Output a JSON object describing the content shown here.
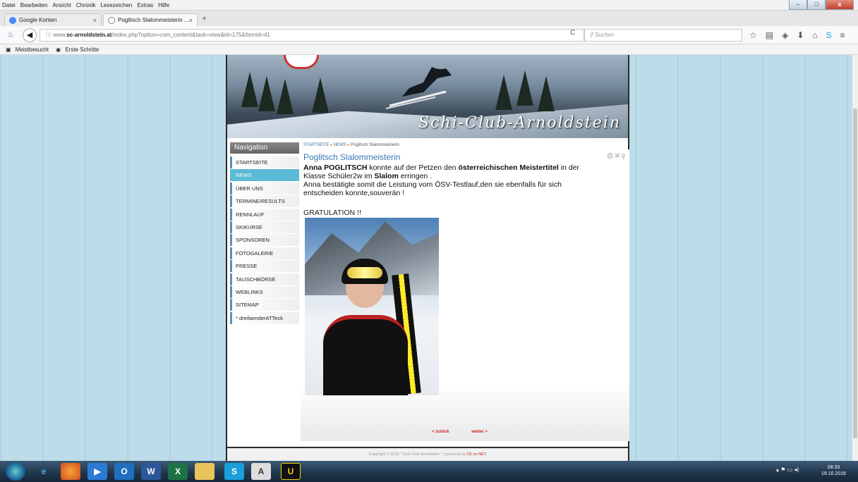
{
  "menubar": {
    "items": [
      "Datei",
      "Bearbeiten",
      "Ansicht",
      "Chronik",
      "Lesezeichen",
      "Extras",
      "Hilfe"
    ]
  },
  "window_controls": {
    "minimize": "–",
    "maximize": "□",
    "close": "x"
  },
  "tabs": [
    {
      "label": "Google Konten",
      "close": "×"
    },
    {
      "label": "Poglitsch Slalommeisterin ...",
      "close": "×"
    }
  ],
  "newtab_label": "+",
  "nav": {
    "url_prefix": "www.",
    "url_host": "sc-arnoldstein.at",
    "url_path": "/index.php?option=com_content&task=view&id=175&Itemid=41",
    "reload": "C",
    "search_placeholder": "Suchen"
  },
  "toolbar_icons": [
    "star-icon",
    "bookmark-list-icon",
    "pocket-icon",
    "download-icon",
    "home-icon",
    "skype-icon",
    "menu-icon"
  ],
  "bookmarks": [
    "Meistbesucht",
    "Erste Schritte"
  ],
  "banner": {
    "title": "Schi-Club-Arnoldstein"
  },
  "sidebar": {
    "heading": "Navigation",
    "items": [
      {
        "label": "STARTSEITE"
      },
      {
        "label": "NEWS"
      },
      {
        "label": "ÜBER UNS"
      },
      {
        "label": "TERMINE/RESULTS"
      },
      {
        "label": "RENNLAUF"
      },
      {
        "label": "SKIKURSE"
      },
      {
        "label": "SPONSOREN"
      },
      {
        "label": "FOTOGALERIE"
      },
      {
        "label": "PRESSE"
      },
      {
        "label": "TAUSCHBÖRSE"
      },
      {
        "label": "WEBLINKS"
      },
      {
        "label": "SITEMAP"
      },
      {
        "label": "* dreilaenderATTeck"
      }
    ]
  },
  "breadcrumb": {
    "items": [
      "STARTSEITE",
      "NEWS",
      "Poglitsch Slalommeisterin"
    ]
  },
  "article": {
    "title": "Poglitsch Slalommeisterin",
    "icons": "⎙ ✉ ⚲",
    "p1_a": "Anna POGLITSCH",
    "p1_b": " konnte auf der Petzen den ",
    "p1_c": "österreichischen Meistertitel",
    "p1_d": " in der Klasse Schüler2w im ",
    "p1_e": "Slalom",
    "p1_f": " erringen .",
    "p2": "Anna bestätigte somit die Leistung vom ÖSV-Testlauf,den sie ebenfalls für sich entscheiden konnte,souverän !",
    "gratulation": "GRATULATION !!",
    "prev": "< zurück",
    "next": "weiter >"
  },
  "footer": {
    "text": "Copyright © 2016 * Schi Club Arnoldstein * | powered by ",
    "link": "CK on NET"
  },
  "taskbar": {
    "time": "08:33",
    "date": "19.10.2016"
  }
}
